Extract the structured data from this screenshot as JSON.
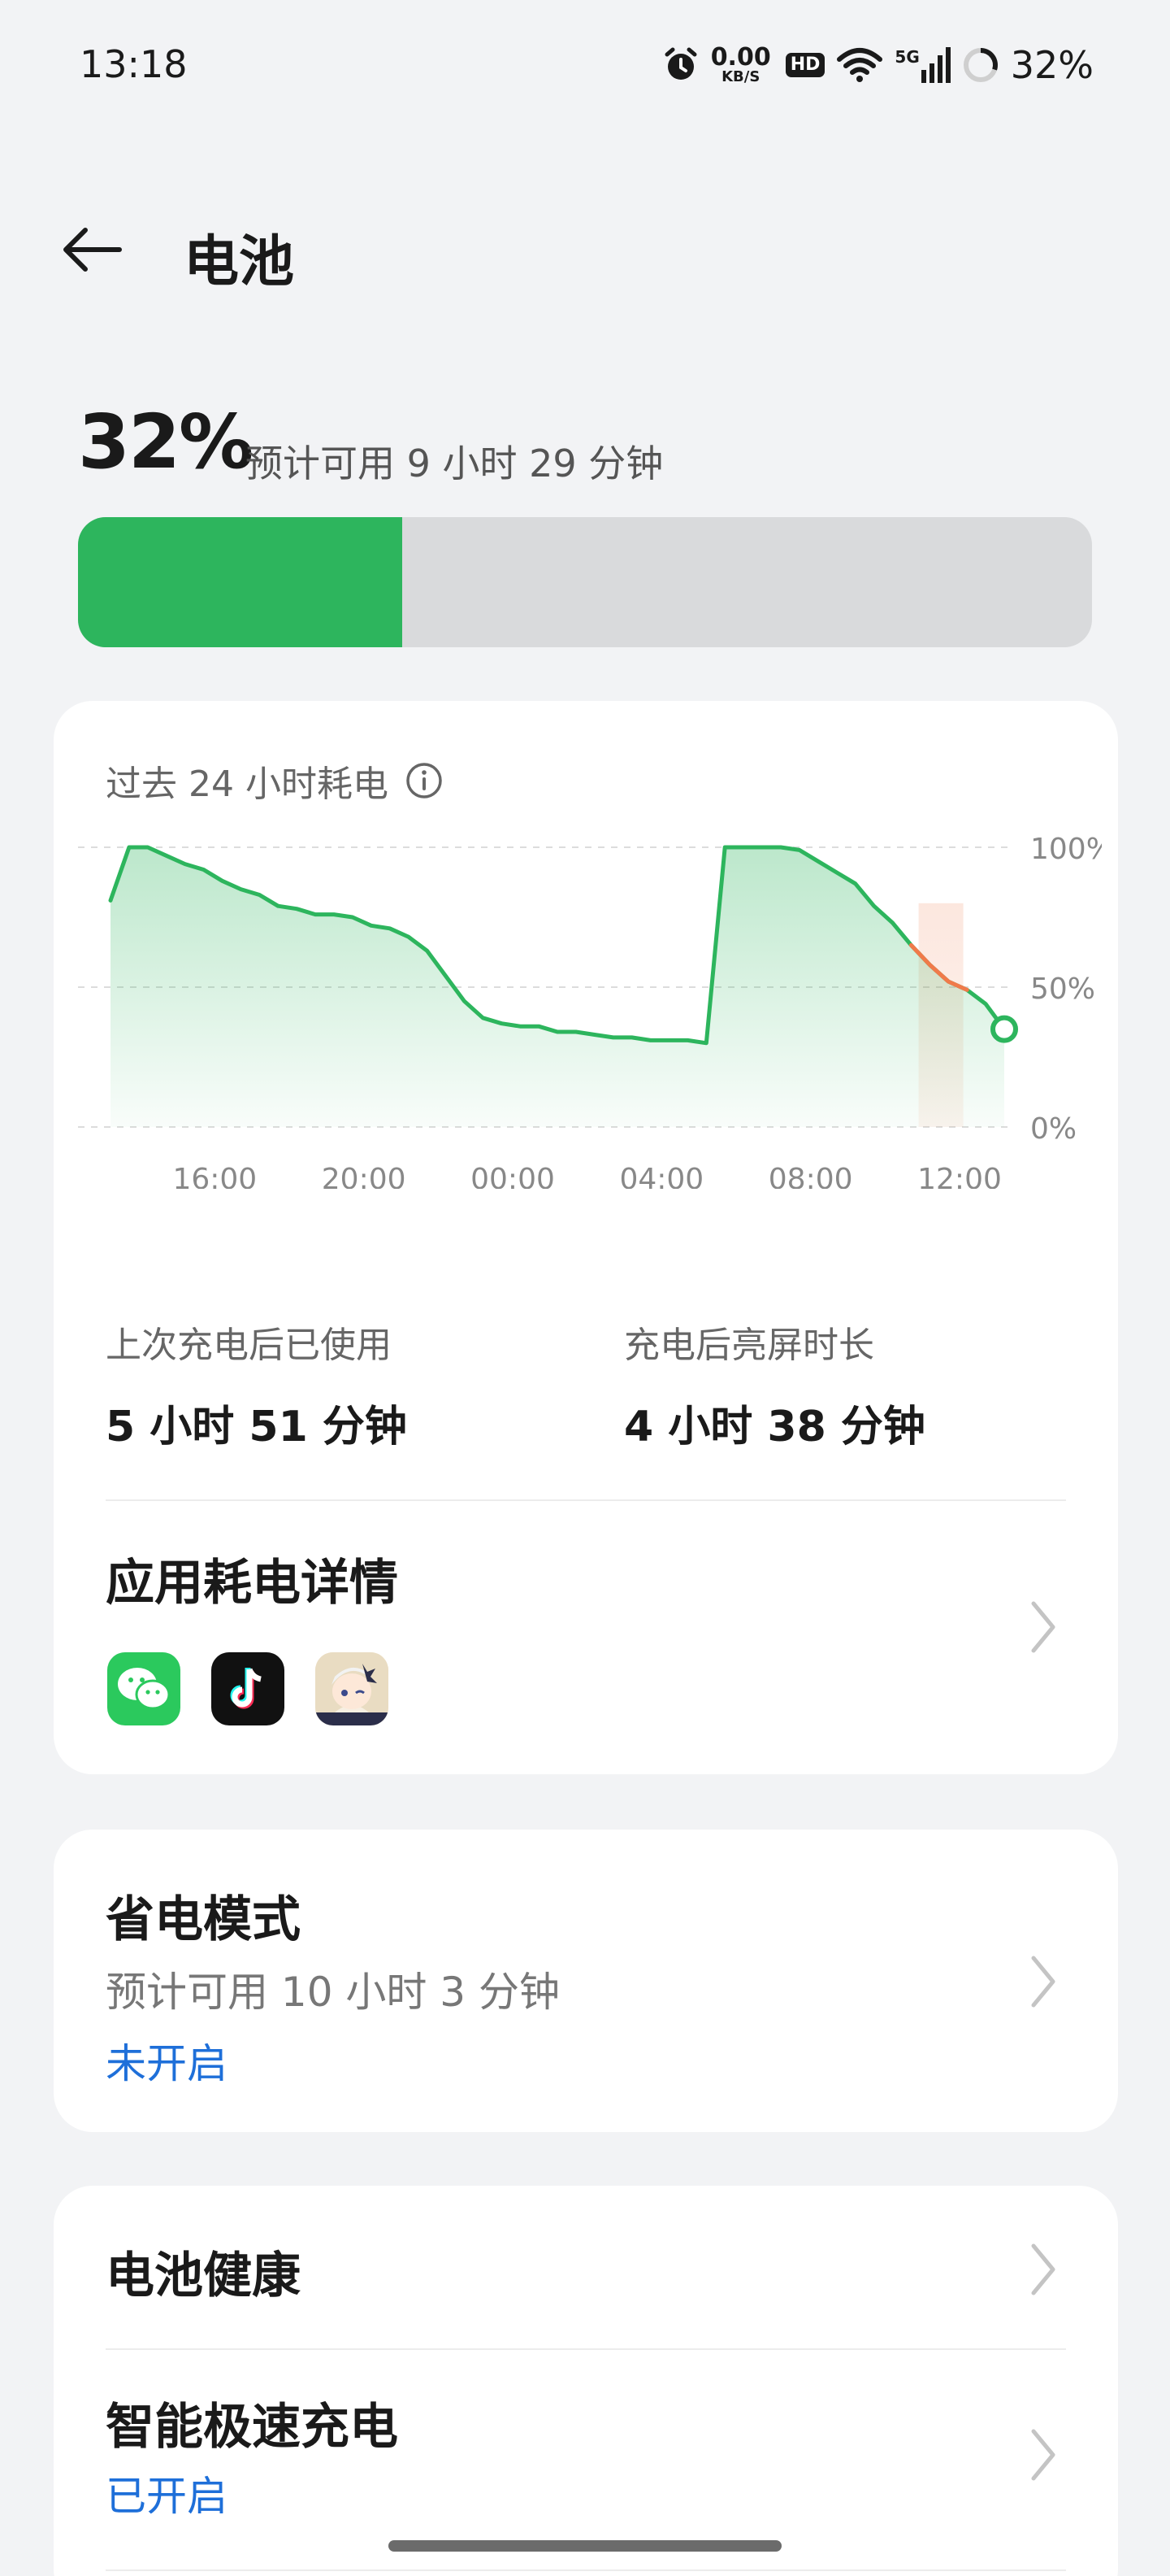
{
  "status_bar": {
    "time": "13:18",
    "net_speed_value": "0.00",
    "net_speed_unit": "KB/S",
    "hd_badge": "HD",
    "network_type": "5G",
    "battery_percent": "32%",
    "icons": [
      "alarm-icon",
      "hd-icon",
      "wifi-icon",
      "signal-icon",
      "battery-ring-icon"
    ]
  },
  "header": {
    "title": "电池",
    "back_icon": "arrow-left-icon"
  },
  "battery": {
    "level_text": "32%",
    "level_fraction": 0.32,
    "estimate": "预计可用 9 小时 29 分钟",
    "fill_color": "#2db55d"
  },
  "usage": {
    "title": "过去 24 小时耗电",
    "info_icon": "info-icon",
    "stats": [
      {
        "label": "上次充电后已使用",
        "value": "5 小时 51 分钟"
      },
      {
        "label": "充电后亮屏时长",
        "value": "4 小时 38 分钟"
      }
    ],
    "app_detail": {
      "title": "应用耗电详情",
      "apps": [
        "wechat-icon",
        "tiktok-icon",
        "game-avatar-icon"
      ]
    }
  },
  "chart_data": {
    "type": "area",
    "title": "",
    "xlabel": "",
    "ylabel": "",
    "x_tick_labels": [
      "16:00",
      "20:00",
      "00:00",
      "04:00",
      "08:00",
      "12:00"
    ],
    "y_tick_labels": [
      "100%",
      "50%",
      "0%"
    ],
    "ylim": [
      0,
      100
    ],
    "xlim": [
      13.2,
      37.2
    ],
    "grid": true,
    "line_color": "#2db55d",
    "highlight_color": "#f07a4a",
    "series": [
      {
        "x": [
          13.2,
          13.7,
          14.2,
          14.7,
          15.2,
          15.7,
          16.2,
          16.7,
          17.2,
          17.7,
          18.2,
          18.7,
          19.2,
          19.7,
          20.2,
          20.7,
          21.2,
          21.7,
          22.2,
          22.7,
          23.2,
          23.7,
          24.2,
          24.7,
          25.2,
          25.7,
          26.2,
          26.7,
          27.2,
          27.7,
          28.2,
          28.7,
          29.2,
          29.7,
          30.2,
          30.7,
          31.2,
          31.7,
          32.2,
          32.7,
          33.2,
          33.7,
          34.2,
          34.7,
          35.2,
          35.7,
          36.2,
          36.7,
          37.2
        ],
        "y": [
          81,
          100,
          100,
          97,
          94,
          92,
          88,
          85,
          83,
          79,
          78,
          76,
          76,
          75,
          72,
          71,
          68,
          63,
          54,
          45,
          39,
          37,
          36,
          36,
          34,
          34,
          33,
          32,
          32,
          31,
          31,
          31,
          30,
          100,
          100,
          100,
          100,
          99,
          95,
          91,
          87,
          79,
          73,
          65,
          58,
          52,
          49,
          44,
          35
        ]
      }
    ],
    "highlight_ranges": [
      [
        34.9,
        36.1
      ]
    ]
  },
  "power_saving": {
    "title": "省电模式",
    "subtitle": "预计可用 10 小时 3 分钟",
    "status": "未开启"
  },
  "battery_health": {
    "title": "电池健康"
  },
  "fast_charge": {
    "title": "智能极速充电",
    "status": "已开启"
  }
}
